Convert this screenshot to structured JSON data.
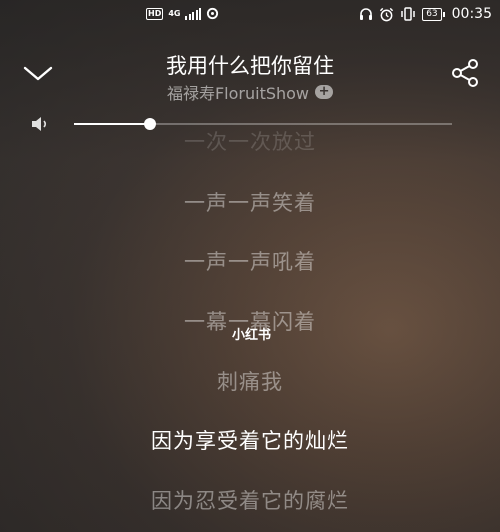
{
  "status_bar": {
    "network_badge": "HD",
    "network_type": "4G",
    "battery": "63",
    "time": "00:35",
    "icons": [
      "hd-icon",
      "signal-icon",
      "data-saver-icon",
      "headphones-icon",
      "alarm-icon",
      "vibrate-icon",
      "battery-icon"
    ]
  },
  "player": {
    "song_title": "我用什么把你留住",
    "artist": "福禄寿FloruitShow",
    "follow_symbol": "+",
    "volume_percent": 20
  },
  "lyrics": [
    {
      "text": "一次一次放过",
      "state": "faded"
    },
    {
      "text": "一声一声笑着",
      "state": "normal"
    },
    {
      "text": "一声一声吼着",
      "state": "normal"
    },
    {
      "text": "一幕一幕闪着",
      "state": "normal"
    },
    {
      "text": "刺痛我",
      "state": "normal"
    },
    {
      "text": "因为享受着它的灿烂",
      "state": "current"
    },
    {
      "text": "因为忍受着它的腐烂",
      "state": "normal"
    }
  ],
  "watermark": "小红书",
  "colors": {
    "background": "#3f3733",
    "accent": "#ffffff"
  }
}
